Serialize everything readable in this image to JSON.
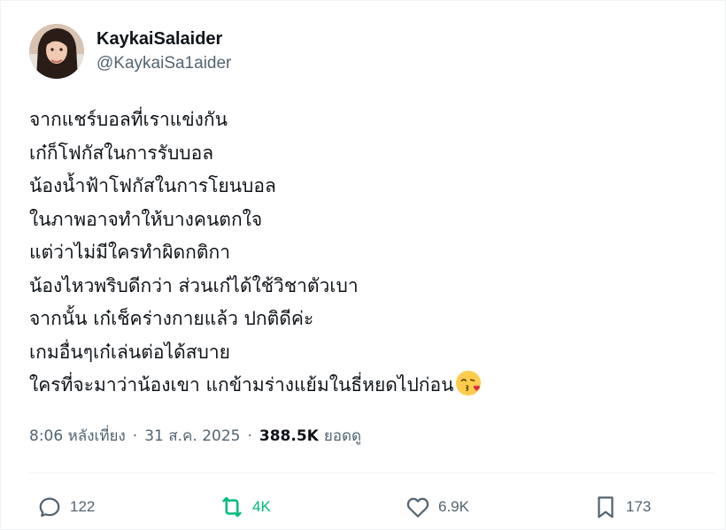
{
  "author": {
    "display_name": "KaykaiSalaider",
    "handle": "@KaykaiSa1aider"
  },
  "post": {
    "lines": [
      "จากแชร์บอลที่เราแข่งกัน",
      "เก๋ก็โฟกัสในการรับบอล",
      "น้องน้ำฟ้าโฟกัสในการโยนบอล",
      "ในภาพอาจทำให้บางคนตกใจ",
      "แต่ว่าไม่มีใครทำผิดกติกา",
      "น้องไหวพริบดีกว่า ส่วนเก๋ได้ใช้วิชาตัวเบา",
      "จากนั้น เก๋เช็คร่างกายแล้ว ปกติดีค่ะ",
      "เกมอื่นๆเก๋เล่นต่อได้สบาย",
      "ใครที่จะมาว่าน้องเขา แกข้ามร่างแย้มในธี่หยดไปก่อน"
    ],
    "emoji": "face-blowing-a-kiss"
  },
  "meta": {
    "time": "8:06 หลังเที่ยง",
    "separator": "·",
    "date": "31 ส.ค. 2025",
    "views_count": "388.5K",
    "views_label": "ยอดดู"
  },
  "actions": {
    "reply_count": "122",
    "repost_count": "4K",
    "like_count": "6.9K",
    "bookmark_count": "173",
    "repost_color": "#00ba7c",
    "muted_color": "#536471"
  }
}
